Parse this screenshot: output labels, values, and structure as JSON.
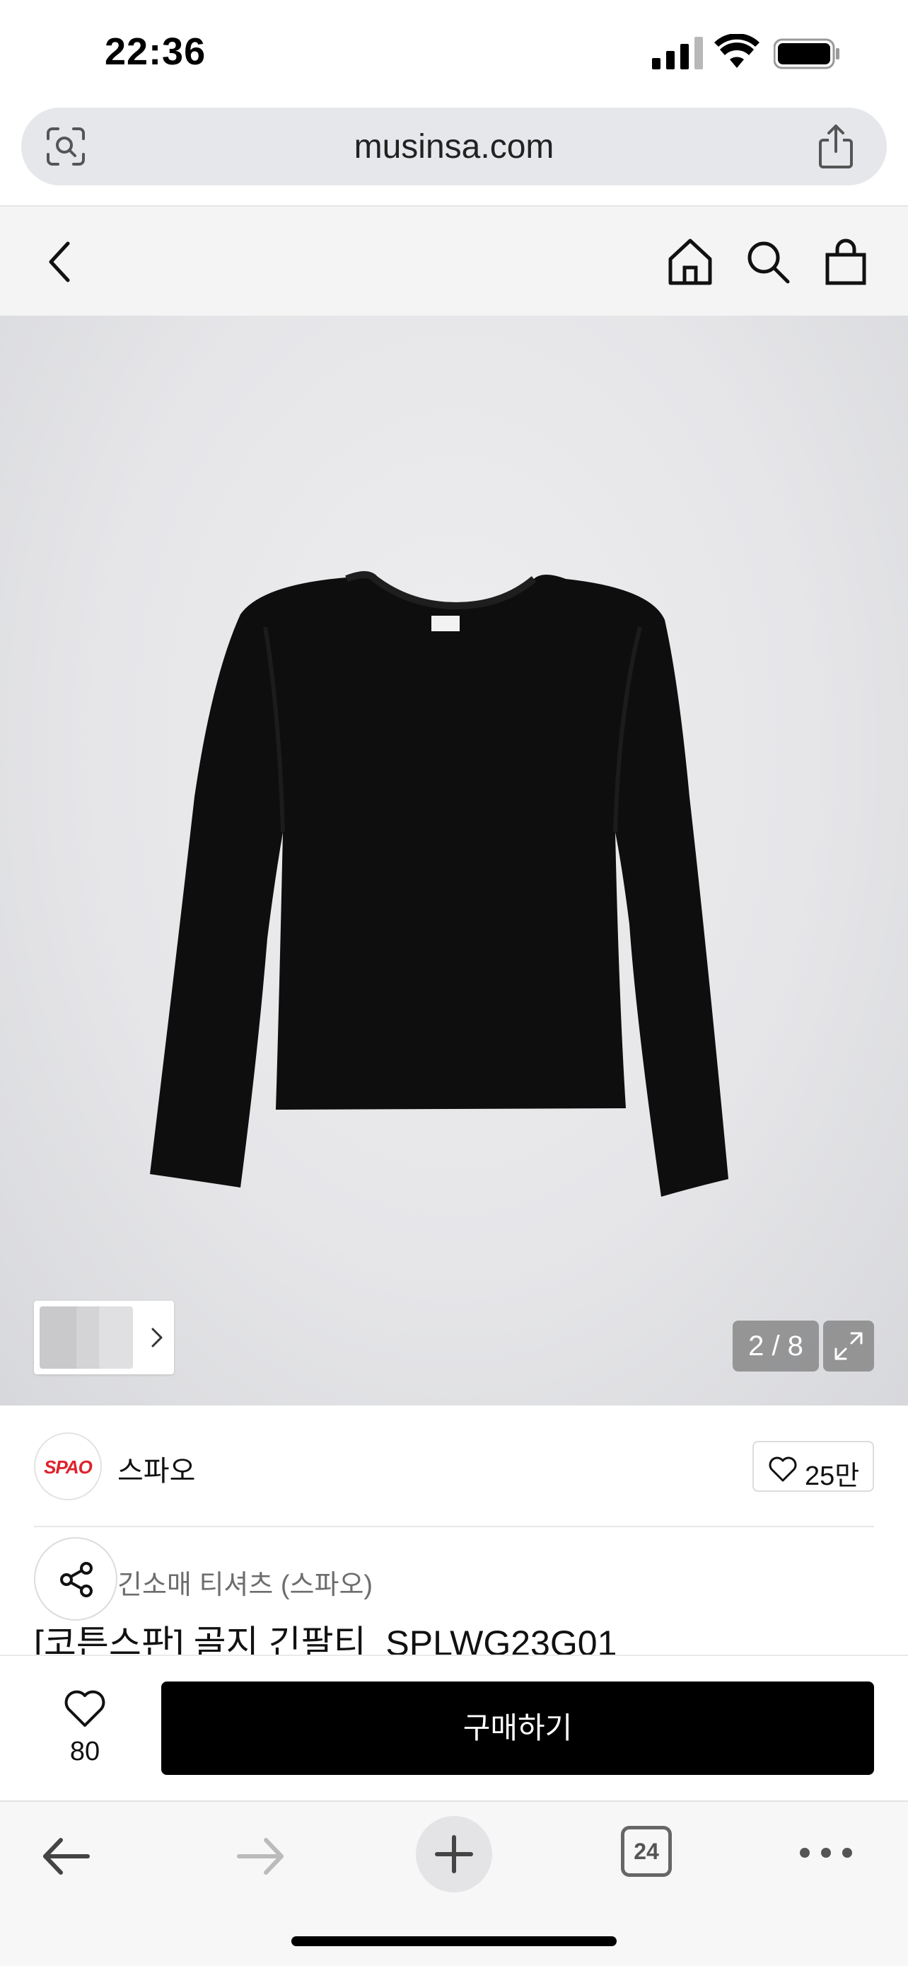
{
  "status_bar": {
    "time": "22:36"
  },
  "browser": {
    "url": "musinsa.com",
    "tab_count": "24"
  },
  "header": {
    "icons": [
      "back-icon",
      "home-icon",
      "search-icon",
      "bag-icon"
    ]
  },
  "gallery": {
    "counter": "2 / 8"
  },
  "brand": {
    "logo_text": "SPAO",
    "name": "스파오",
    "likes": "25만",
    "logo_color": "#e0222b"
  },
  "product": {
    "category": "긴소매 티셔츠 (스파오)",
    "title": "[코튼스판] 골지 긴팔티_SPLWG23G01"
  },
  "purchase_bar": {
    "wish_count": "80",
    "buy_label": "구매하기",
    "buy_color": "#000000"
  }
}
